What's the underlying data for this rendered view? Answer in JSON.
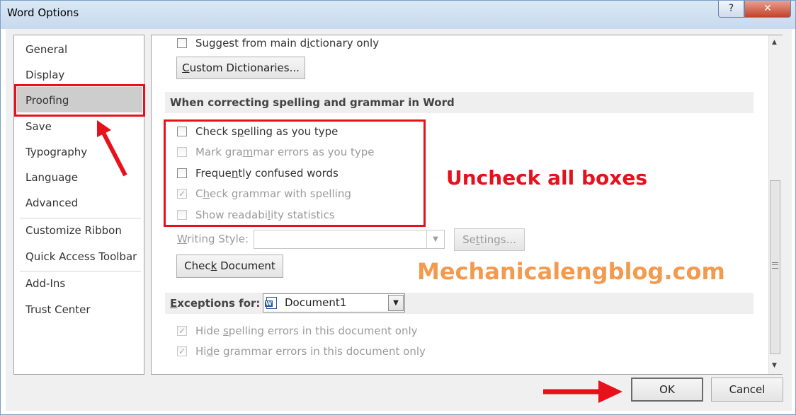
{
  "window": {
    "title": "Word Options",
    "help_label": "?",
    "close_label": "✕"
  },
  "nav": {
    "items": [
      {
        "label": "General"
      },
      {
        "label": "Display"
      },
      {
        "label": "Proofing"
      },
      {
        "label": "Save"
      },
      {
        "label": "Typography"
      },
      {
        "label": "Language"
      },
      {
        "label": "Advanced"
      },
      {
        "label": "Customize Ribbon"
      },
      {
        "label": "Quick Access Toolbar"
      },
      {
        "label": "Add-Ins"
      },
      {
        "label": "Trust Center"
      }
    ],
    "selected": "Proofing"
  },
  "top": {
    "suggest_main_dict": {
      "label_a": "Suggest from main d",
      "label_u": "i",
      "label_b": "ctionary only",
      "checked": false
    },
    "custom_dict_button": {
      "u": "C",
      "rest": "ustom Dictionaries..."
    }
  },
  "spelling_section": {
    "header": "When correcting spelling and grammar in Word",
    "options": [
      {
        "a": "Check s",
        "u": "p",
        "b": "elling as you type",
        "checked": false,
        "disabled": false
      },
      {
        "a": "Mark gra",
        "u": "m",
        "b": "mar errors as you type",
        "checked": false,
        "disabled": true
      },
      {
        "a": "Freque",
        "u": "n",
        "b": "tly confused words",
        "checked": false,
        "disabled": false
      },
      {
        "a": "C",
        "u": "h",
        "b": "eck grammar with spelling",
        "checked": true,
        "disabled": true
      },
      {
        "a": "Show readabi",
        "u": "l",
        "b": "ity statistics",
        "checked": false,
        "disabled": true
      }
    ],
    "writing_style": {
      "u": "W",
      "rest": "riting Style:",
      "value": ""
    },
    "settings_button": {
      "a": "Se",
      "u": "t",
      "b": "tings..."
    },
    "check_document_button": {
      "a": "Chec",
      "u": "k",
      "b": " Document"
    }
  },
  "exceptions": {
    "label_u": "E",
    "label_rest": "xceptions for:",
    "document": "Document1",
    "options": [
      {
        "a": "Hide ",
        "u": "s",
        "b": "pelling errors in this document only",
        "checked": true
      },
      {
        "a": "Hi",
        "u": "d",
        "b": "e grammar errors in this document only",
        "checked": true
      }
    ]
  },
  "footer": {
    "ok": "OK",
    "cancel": "Cancel"
  },
  "annotations": {
    "instruction": "Uncheck all boxes",
    "watermark": "Mechanicalengblog.com"
  },
  "colors": {
    "annotation_red": "#e8101a",
    "watermark_orange": "#f39a4e"
  },
  "icons": [
    "help-icon",
    "close-icon",
    "checkbox-icon",
    "dropdown-arrow-icon",
    "word-document-icon",
    "scroll-up-icon",
    "scroll-down-icon",
    "scroll-grip-icon",
    "red-arrow-icon"
  ]
}
